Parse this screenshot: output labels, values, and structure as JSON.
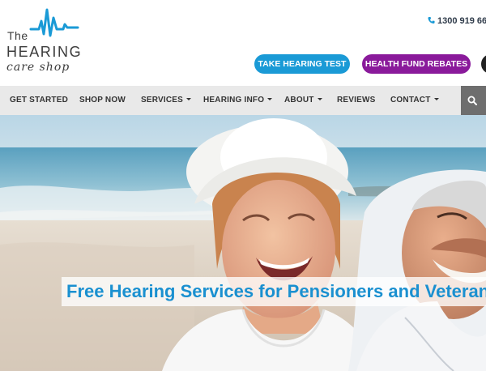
{
  "brand": {
    "line1": "The",
    "line2": "HEARING",
    "line3": "care shop",
    "accent_color": "#1a9ad6"
  },
  "header": {
    "phone": "1300 919 66",
    "phone_icon": "phone-icon",
    "buttons": {
      "hearing_test": "TAKE HEARING TEST",
      "fund_rebates": "HEALTH FUND REBATES"
    },
    "button_colors": {
      "hearing_test": "#1a9ad6",
      "fund_rebates": "#8a1a9b"
    }
  },
  "nav": {
    "items": [
      {
        "label": "GET STARTED",
        "dropdown": false
      },
      {
        "label": "SHOP NOW",
        "dropdown": false
      },
      {
        "label": "SERVICES",
        "dropdown": true
      },
      {
        "label": "HEARING INFO",
        "dropdown": true
      },
      {
        "label": "ABOUT",
        "dropdown": true
      },
      {
        "label": "REVIEWS",
        "dropdown": false
      },
      {
        "label": "CONTACT",
        "dropdown": true
      }
    ],
    "search_icon": "search-icon"
  },
  "hero": {
    "headline": "Free Hearing Services for Pensioners and Veteran"
  }
}
